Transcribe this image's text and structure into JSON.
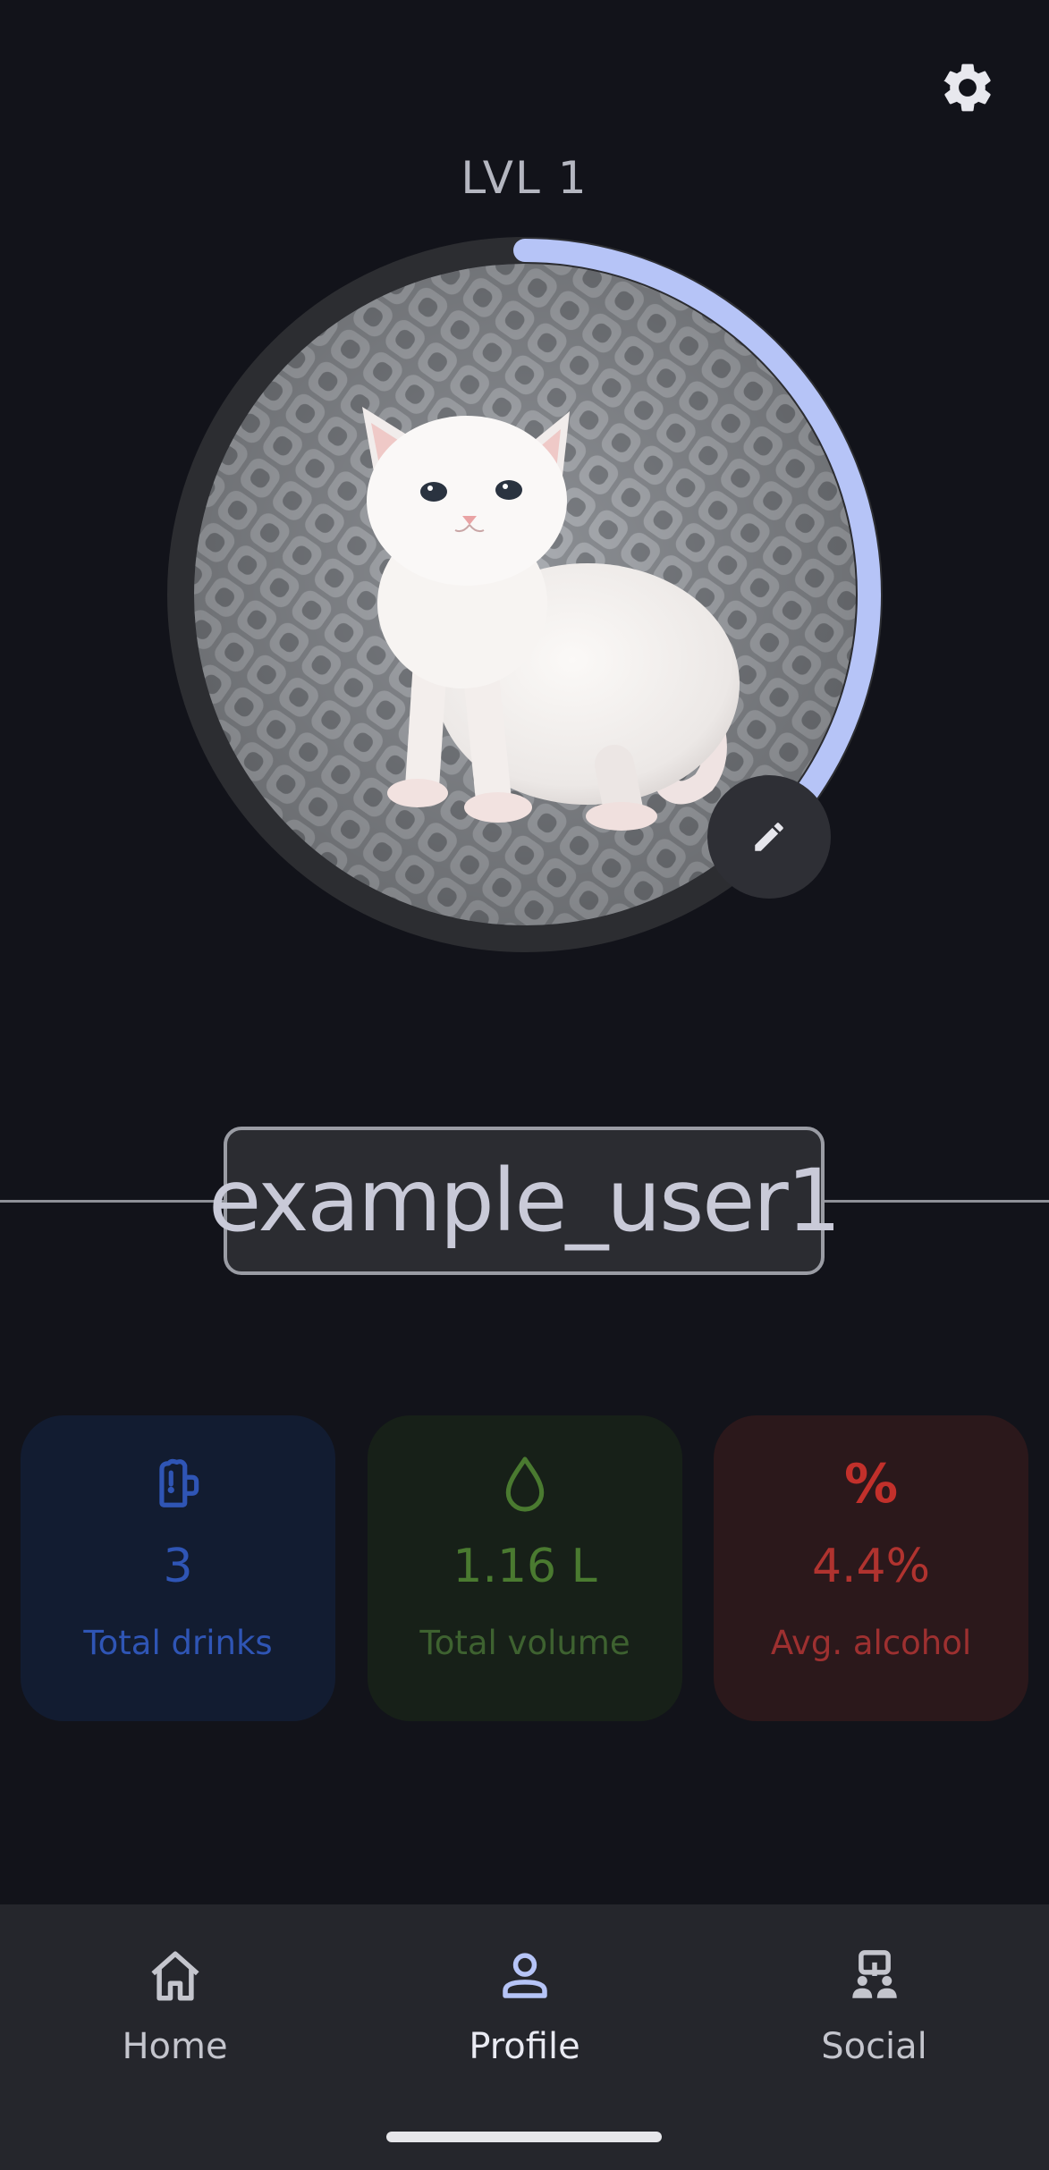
{
  "header": {
    "settings_icon": "gear-icon"
  },
  "profile": {
    "level_label": "LVL 1",
    "level_progress": 0.38,
    "avatar_subject": "white kitten on gray knit blanket",
    "edit_icon": "pencil-icon",
    "username": "example_user1"
  },
  "stats": [
    {
      "icon": "beer-mug-icon",
      "value": "3",
      "label": "Total drinks",
      "color": "#2f55b5"
    },
    {
      "icon": "water-drop-icon",
      "value": "1.16 L",
      "label": "Total volume",
      "color": "#4a7a30"
    },
    {
      "icon": "percent-icon",
      "icon_glyph": "%",
      "value": "4.4%",
      "label": "Avg. alcohol",
      "color": "#b0332f"
    }
  ],
  "nav": {
    "items": [
      {
        "label": "Home",
        "icon": "home-icon",
        "active": false
      },
      {
        "label": "Profile",
        "icon": "person-icon",
        "active": true
      },
      {
        "label": "Social",
        "icon": "social-network-icon",
        "active": false
      }
    ]
  },
  "colors": {
    "background": "#12131a",
    "accent_ring": "#b6c4f7",
    "ring_track": "#2c2d31",
    "nav_background": "#25262c"
  }
}
